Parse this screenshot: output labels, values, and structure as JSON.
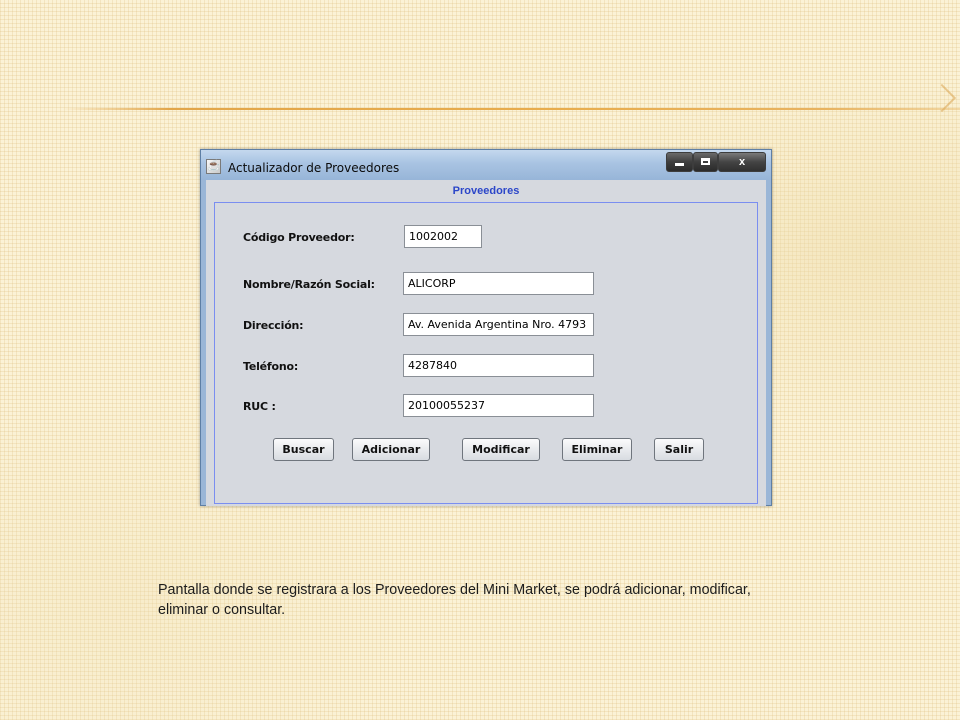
{
  "window": {
    "title": "Actualizador de Proveedores",
    "icon": "java-app-icon",
    "controls": {
      "minimize": "minimize-icon",
      "maximize": "maximize-icon",
      "close_label": "x"
    }
  },
  "panel": {
    "title": "Proveedores"
  },
  "form": {
    "codigo": {
      "label": "Código Proveedor:",
      "value": "1002002"
    },
    "nombre": {
      "label": "Nombre/Razón Social:",
      "value": "ALICORP"
    },
    "direccion": {
      "label": "Dirección:",
      "value": "Av. Avenida Argentina Nro. 4793"
    },
    "telefono": {
      "label": "Teléfono:",
      "value": "4287840"
    },
    "ruc": {
      "label": "RUC :",
      "value": "20100055237"
    }
  },
  "buttons": {
    "buscar": "Buscar",
    "adicionar": "Adicionar",
    "modificar": "Modificar",
    "eliminar": "Eliminar",
    "salir": "Salir"
  },
  "slide": {
    "caption": "Pantalla donde se registrara a los Proveedores del Mini Market, se podrá adicionar, modificar, eliminar o consultar."
  },
  "colors": {
    "slide_background": "#fbf2d6",
    "title_rule": "#e8ad4e",
    "window_frame": "#9ab6d7",
    "panel_title": "#2b46c9",
    "panel_border": "#7a8ef0"
  }
}
